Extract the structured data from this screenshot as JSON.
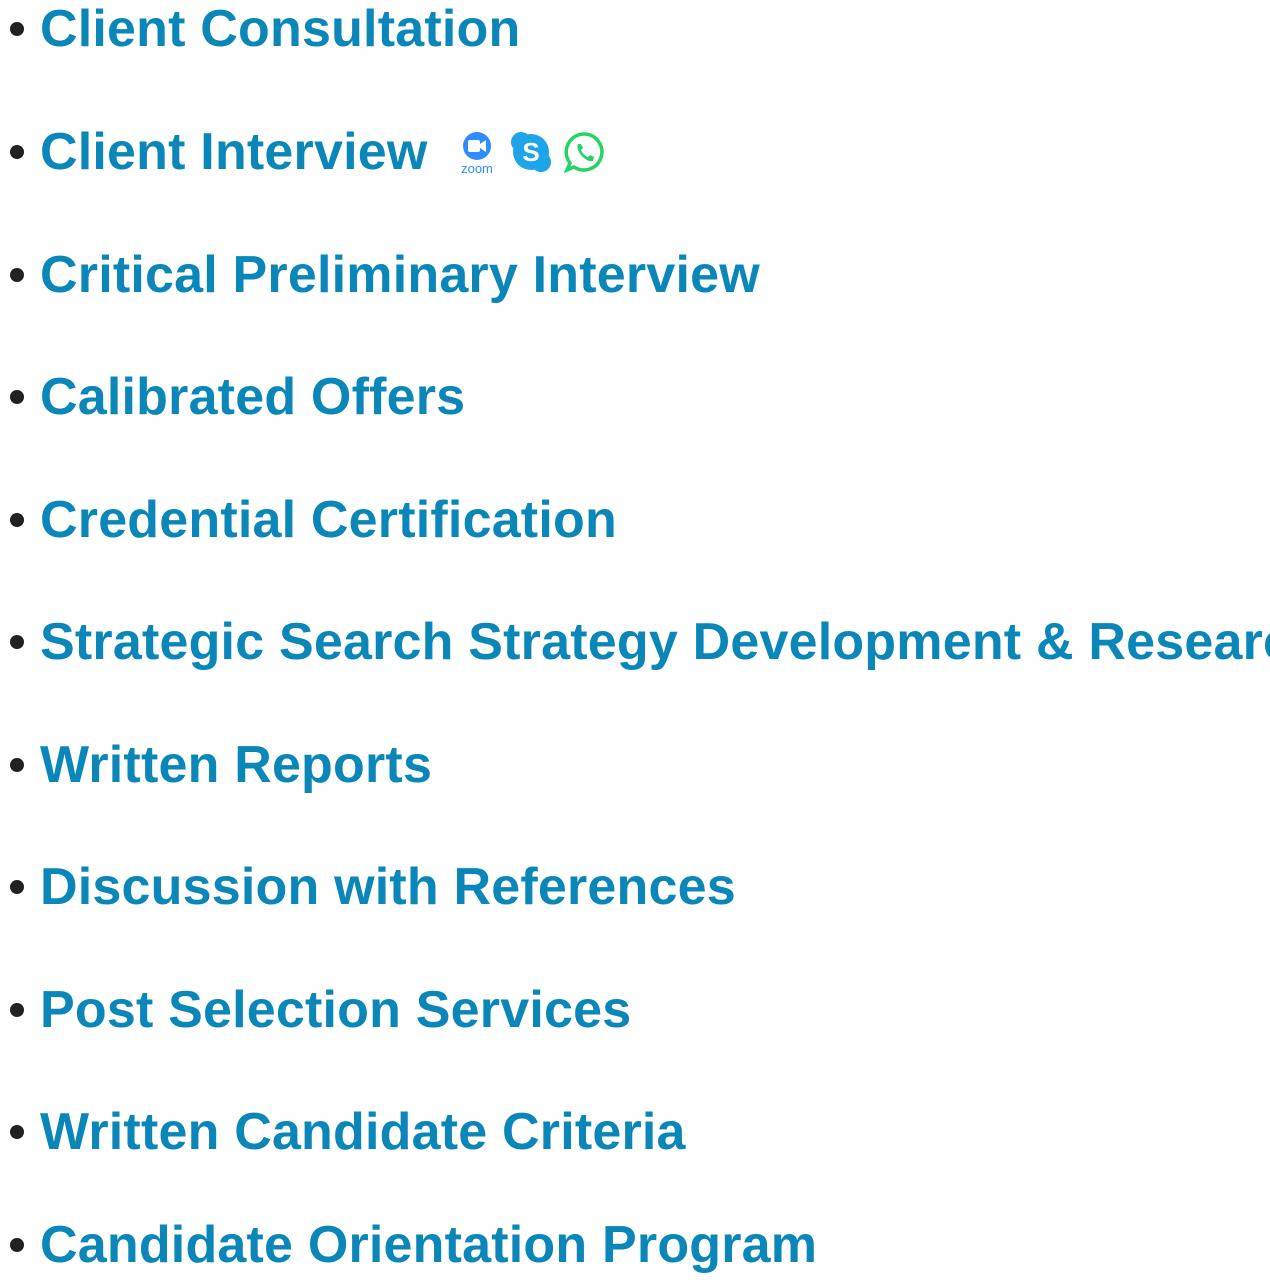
{
  "services": {
    "items": [
      {
        "label": "Client Consultation"
      },
      {
        "label": "Client Interview"
      },
      {
        "label": "Critical Preliminary Interview"
      },
      {
        "label": "Calibrated Offers"
      },
      {
        "label": "Credential Certification"
      },
      {
        "label": "Strategic Search Strategy Development & Research"
      },
      {
        "label": "Written Reports"
      },
      {
        "label": "Discussion with References"
      },
      {
        "label": "Post Selection Services"
      },
      {
        "label": "Written Candidate Criteria"
      },
      {
        "label": "Candidate Orientation Program"
      }
    ],
    "interview_icons": [
      {
        "name": "zoom-icon",
        "caption": "zoom",
        "color": "#2d8cff"
      },
      {
        "name": "skype-icon",
        "caption": "S",
        "color": "#1ea5e8"
      },
      {
        "name": "whatsapp-icon",
        "caption": "",
        "color": "#25d366"
      }
    ]
  },
  "colors": {
    "link": "#0a87b8",
    "bullet": "#222222",
    "background": "#ffffff"
  }
}
